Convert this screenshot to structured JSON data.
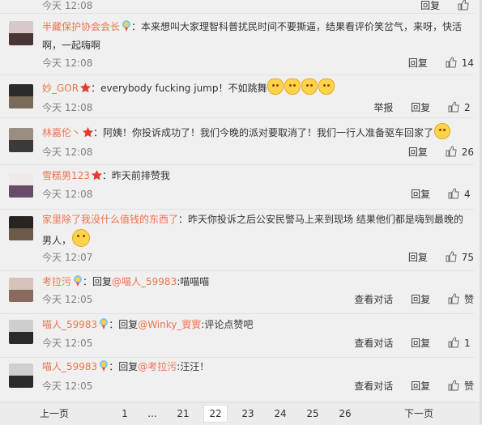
{
  "comments": [
    {
      "username": "",
      "time": "今天 12:08",
      "actions": {
        "reply": "回复",
        "likes": ""
      }
    },
    {
      "username": "半藏保护协会会长",
      "text": "：本来想叫大家理智科普扰民时间不要撕逼，结果看评价笑岔气，来呀，快活啊，一起嗨啊",
      "time": "今天 12:08",
      "actions": {
        "reply": "回复",
        "likes": "14"
      }
    },
    {
      "username": "妙_GOR",
      "text": "：everybody fucking jump！不如跳舞",
      "time": "今天 12:08",
      "actions": {
        "report": "举报",
        "reply": "回复",
        "likes": "2"
      }
    },
    {
      "username": "林嘉伦丶",
      "text": "：阿姨！你投诉成功了！我们今晚的派对要取消了！我们一行人准备驱车回家了",
      "time": "今天 12:08",
      "actions": {
        "reply": "回复",
        "likes": "26"
      }
    },
    {
      "username": "雪糕男123",
      "text": "：昨天前排赞我",
      "time": "今天 12:08",
      "actions": {
        "reply": "回复",
        "likes": "4"
      }
    },
    {
      "username": "家里除了我没什么值钱的东西了",
      "text": "：昨天你投诉之后公安民警马上来到现场 结果他们都是嗨到最晚的男人，",
      "time": "今天 12:07",
      "actions": {
        "reply": "回复",
        "likes": "75"
      }
    },
    {
      "username": "考拉污",
      "reply_prefix": "：回复",
      "reply_to": "@喵人_59983",
      "text": ":喵喵喵",
      "time": "今天 12:05",
      "actions": {
        "view_conversation": "查看对话",
        "reply": "回复",
        "likes": "赞"
      }
    },
    {
      "username": "喵人_59983",
      "reply_prefix": "：回复",
      "reply_to": "@Winky_賨賨",
      "text": ":评论点赞吧",
      "time": "今天 12:05",
      "actions": {
        "view_conversation": "查看对话",
        "reply": "回复",
        "likes": "1"
      }
    },
    {
      "username": "喵人_59983",
      "reply_prefix": "：回复",
      "reply_to": "@考拉污",
      "text": ":汪汪！",
      "time": "今天 12:05",
      "actions": {
        "view_conversation": "查看对话",
        "reply": "回复",
        "likes": "赞"
      }
    }
  ],
  "pagination": {
    "prev": "上一页",
    "next": "下一页",
    "pages": [
      "1",
      "...",
      "21",
      "22",
      "23",
      "24",
      "25",
      "26"
    ],
    "current": "22"
  },
  "colors": {
    "username": "#eb7350",
    "badge_red": "#e83a2b",
    "text": "#333333",
    "meta": "#808080"
  }
}
